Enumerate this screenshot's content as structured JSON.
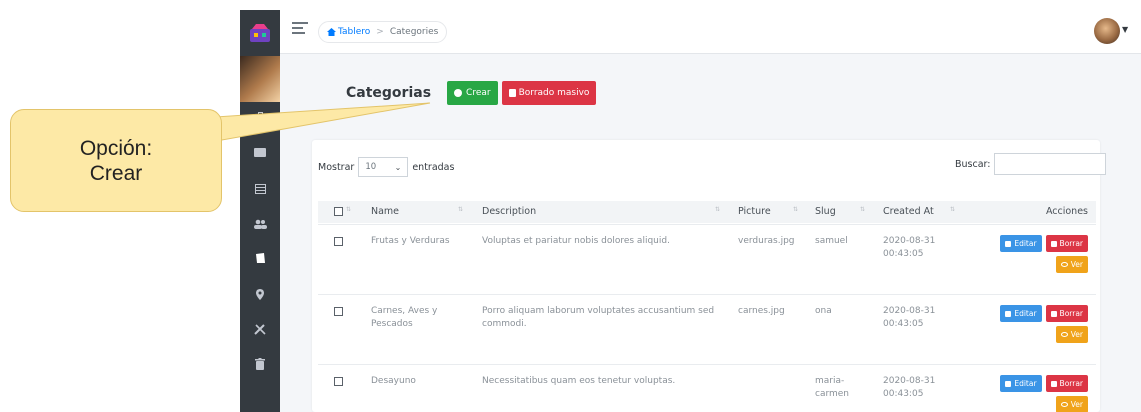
{
  "topbar": {
    "breadcrumb": {
      "home": "Tablero",
      "separator": ">",
      "current": "Categories"
    }
  },
  "page": {
    "title": "Categorias",
    "create_label": "Crear",
    "bulk_delete_label": "Borrado masivo"
  },
  "table_controls": {
    "show_label": "Mostrar",
    "length_value": "10",
    "entries_label": "entradas",
    "search_label": "Buscar:",
    "search_value": ""
  },
  "table": {
    "columns": [
      "Name",
      "Description",
      "Picture",
      "Slug",
      "Created At",
      "Acciones"
    ],
    "rows": [
      {
        "name": "Frutas y Verduras",
        "description": "Voluptas et pariatur nobis dolores aliquid.",
        "picture": "verduras.jpg",
        "slug": "samuel",
        "created_at": "2020-08-31 00:43:05"
      },
      {
        "name": "Carnes, Aves y Pescados",
        "description": "Porro aliquam laborum voluptates accusantium sed commodi.",
        "picture": "carnes.jpg",
        "slug": "ona",
        "created_at": "2020-08-31 00:43:05"
      },
      {
        "name": "Desayuno",
        "description": "Necessitatibus quam eos tenetur voluptas.",
        "picture": "",
        "slug": "maria-carmen",
        "created_at": "2020-08-31 00:43:05"
      }
    ],
    "actions": {
      "edit": "Editar",
      "delete": "Borrar",
      "view": "Ver"
    }
  },
  "callout": {
    "text": "Opción: Crear"
  },
  "colors": {
    "sidebar": "#343a40",
    "success": "#28a745",
    "danger": "#dc3545",
    "edit": "#3a94e6",
    "view": "#f0a31a",
    "callout": "#fde9a6"
  },
  "icons": {
    "sidebar": [
      "shop-logo-icon",
      "user-photo",
      "briefcase-icon",
      "money-icon",
      "calendar-icon",
      "users-icon",
      "box-icon",
      "map-pin-icon",
      "tools-icon",
      "trash-icon"
    ],
    "header": [
      "menu-icon",
      "home-icon",
      "user-avatar",
      "chevron-down-icon"
    ]
  }
}
